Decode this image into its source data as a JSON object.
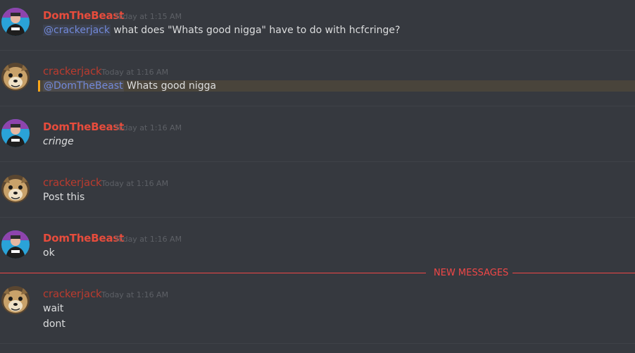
{
  "messages": [
    {
      "author": "DomTheBeast",
      "timestamp": "Today at 1:15 AM",
      "mention": "@crackerjack",
      "text": " what does \"Whats good nigga\" have to do with hcfcringe?"
    },
    {
      "author": "crackerjack",
      "timestamp": "Today at 1:16 AM",
      "mention": "@DomTheBeast",
      "text": " Whats good nigga"
    },
    {
      "author": "DomTheBeast",
      "timestamp": "Today at 1:16 AM",
      "text": "cringe"
    },
    {
      "author": "crackerjack",
      "timestamp": "Today at 1:16 AM",
      "text": "Post this"
    },
    {
      "author": "DomTheBeast",
      "timestamp": "Today at 1:16 AM",
      "text": "ok"
    },
    {
      "author": "crackerjack",
      "timestamp": "Today at 1:16 AM",
      "lines": [
        "wait",
        "dont"
      ]
    }
  ],
  "new_messages_label": "NEW MESSAGES",
  "colors": {
    "background": "#36393f",
    "dom_name": "#e74c3c",
    "crackerjack_name": "#b93b2f",
    "mention": "#7289da",
    "new_messages": "#f04747",
    "mention_highlight_bar": "#faa61a"
  },
  "icons": {
    "dom_avatar": "person-avatar-icon",
    "crackerjack_avatar": "dog-avatar-icon"
  }
}
